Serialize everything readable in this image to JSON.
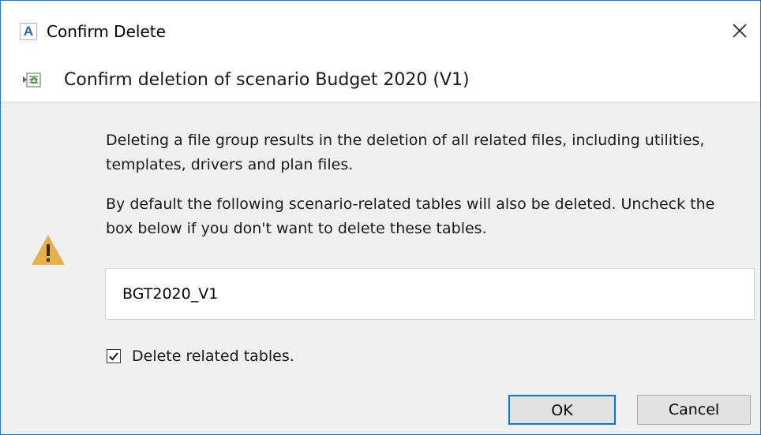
{
  "window": {
    "app_logo_letter": "A",
    "title": "Confirm Delete",
    "close_icon": "close-icon"
  },
  "header": {
    "icon": "scenario-delete-icon",
    "text": "Confirm deletion of scenario Budget 2020 (V1)"
  },
  "body": {
    "warning_icon": "warning-icon",
    "message_1": "Deleting a file group results in the deletion of all related files, including utilities, templates, drivers and plan files.",
    "message_2": "By default the following scenario-related tables will also be deleted. Uncheck the box below if you don't want to delete these tables.",
    "tables": [
      "BGT2020_V1"
    ],
    "checkbox": {
      "label": "Delete related tables.",
      "checked": true
    }
  },
  "buttons": {
    "ok": "OK",
    "cancel": "Cancel"
  },
  "colors": {
    "accent": "#0078d7",
    "border": "#1f77d6",
    "dialog_bg": "#f0f0f0",
    "warning": "#e8b04a"
  }
}
